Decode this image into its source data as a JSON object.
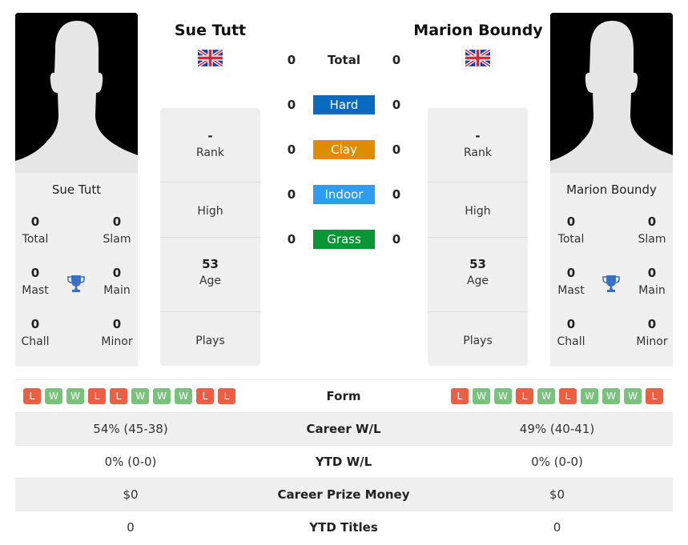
{
  "player1": {
    "name": "Sue Tutt",
    "country_flag": "uk-flag-icon",
    "titles": {
      "total": "0",
      "slam": "0",
      "mast": "0",
      "main": "0",
      "chall": "0",
      "minor": "0"
    },
    "rank": "-",
    "high": "",
    "age": "53",
    "plays": "",
    "form": [
      "L",
      "W",
      "W",
      "L",
      "L",
      "W",
      "W",
      "W",
      "L",
      "L"
    ],
    "career_wl": "54% (45-38)",
    "ytd_wl": "0% (0-0)",
    "career_prize": "$0",
    "ytd_titles": "0"
  },
  "player2": {
    "name": "Marion Boundy",
    "country_flag": "uk-flag-icon",
    "titles": {
      "total": "0",
      "slam": "0",
      "mast": "0",
      "main": "0",
      "chall": "0",
      "minor": "0"
    },
    "rank": "-",
    "high": "",
    "age": "53",
    "plays": "",
    "form": [
      "L",
      "W",
      "W",
      "L",
      "W",
      "L",
      "W",
      "W",
      "W",
      "L"
    ],
    "career_wl": "49% (40-41)",
    "ytd_wl": "0% (0-0)",
    "career_prize": "$0",
    "ytd_titles": "0"
  },
  "labels": {
    "total": "Total",
    "slam": "Slam",
    "mast": "Mast",
    "main": "Main",
    "chall": "Chall",
    "minor": "Minor",
    "rank": "Rank",
    "high": "High",
    "age": "Age",
    "plays": "Plays",
    "form": "Form",
    "career_wl": "Career W/L",
    "ytd_wl": "YTD W/L",
    "career_prize": "Career Prize Money",
    "ytd_titles": "YTD Titles"
  },
  "h2h": [
    {
      "surface": "Total",
      "p1": "0",
      "p2": "0",
      "color": ""
    },
    {
      "surface": "Hard",
      "p1": "0",
      "p2": "0",
      "color": "#0a6abf"
    },
    {
      "surface": "Clay",
      "p1": "0",
      "p2": "0",
      "color": "#e08c00"
    },
    {
      "surface": "Indoor",
      "p1": "0",
      "p2": "0",
      "color": "#2e9cf1"
    },
    {
      "surface": "Grass",
      "p1": "0",
      "p2": "0",
      "color": "#0b9635"
    }
  ]
}
